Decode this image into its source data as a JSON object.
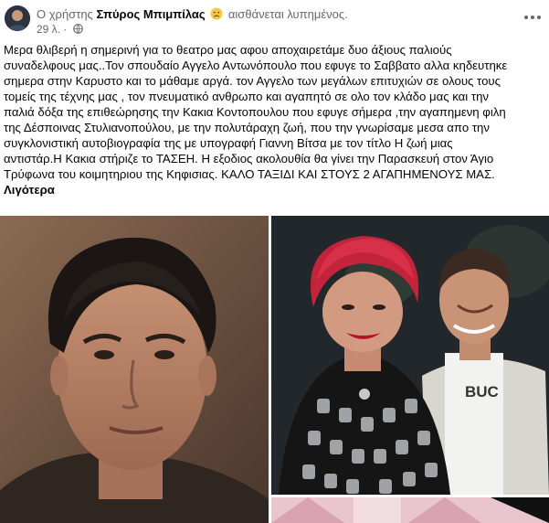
{
  "post": {
    "author_prefix": "Ο χρήστης",
    "author_name": "Σπύρος Μπιμπίλας",
    "feeling": "αισθάνεται λυπημένος.",
    "timestamp": "29 λ. ·",
    "body_lines": [
      "Μερα θλιβερή η σημερινή για το θεατρο μας αφου αποχαιρετάμε δυο άξιους παλιούς",
      "συναδελφους μας..Τον σπουδαίο Αγγελο Αντωνόπουλο που εφυγε το Σαββατο αλλα κηδευτηκε",
      "σημερα στην Καρυστο και το μάθαμε αργά. τον Αγγελο των μεγάλων επιτυχιών σε ολους τους",
      "τομείς της τέχνης μας , τον πνευματικό ανθρωπο και αγαπητό σε ολο τον κλάδο μας και την",
      "παλιά δόξα της επιθεώρησης την Κακια Κοντοπουλου που εφυγε σήμερα ,την αγαπημενη φιλη",
      "της Δέσποινας Στυλιανοπούλου, με την πολυτάραχη ζωή, που την γνωρίσαμε μεσα απο την",
      "συγκλονιστική  αυτοβιογραφία της με υπογραφή Γιαννη Βίτσα με τον τίτλο Η ζωή μιας",
      "αντιστάρ.Η Κακια στήριζε το ΤΑΣΕΗ. Η εξοδιος ακολουθία θα γίνει την Παρασκευή στον Άγιο",
      "Τρύφωνα του κοιμητηριου της Κηφισιας. ΚΑΛΟ ΤΑΞΙΔΙ ΚΑΙ ΣΤΟΥΣ 2 ΑΓΑΠΗΜΕΝΟΥΣ ΜΑΣ."
    ],
    "see_less": "Λιγότερα",
    "shirt_text": "BUC"
  },
  "icons": {
    "feeling": "sad-face-icon",
    "audience": "globe-icon",
    "menu": "more-options-icon"
  },
  "colors": {
    "secondary_text": "#65676b",
    "primary_text": "#050505"
  }
}
